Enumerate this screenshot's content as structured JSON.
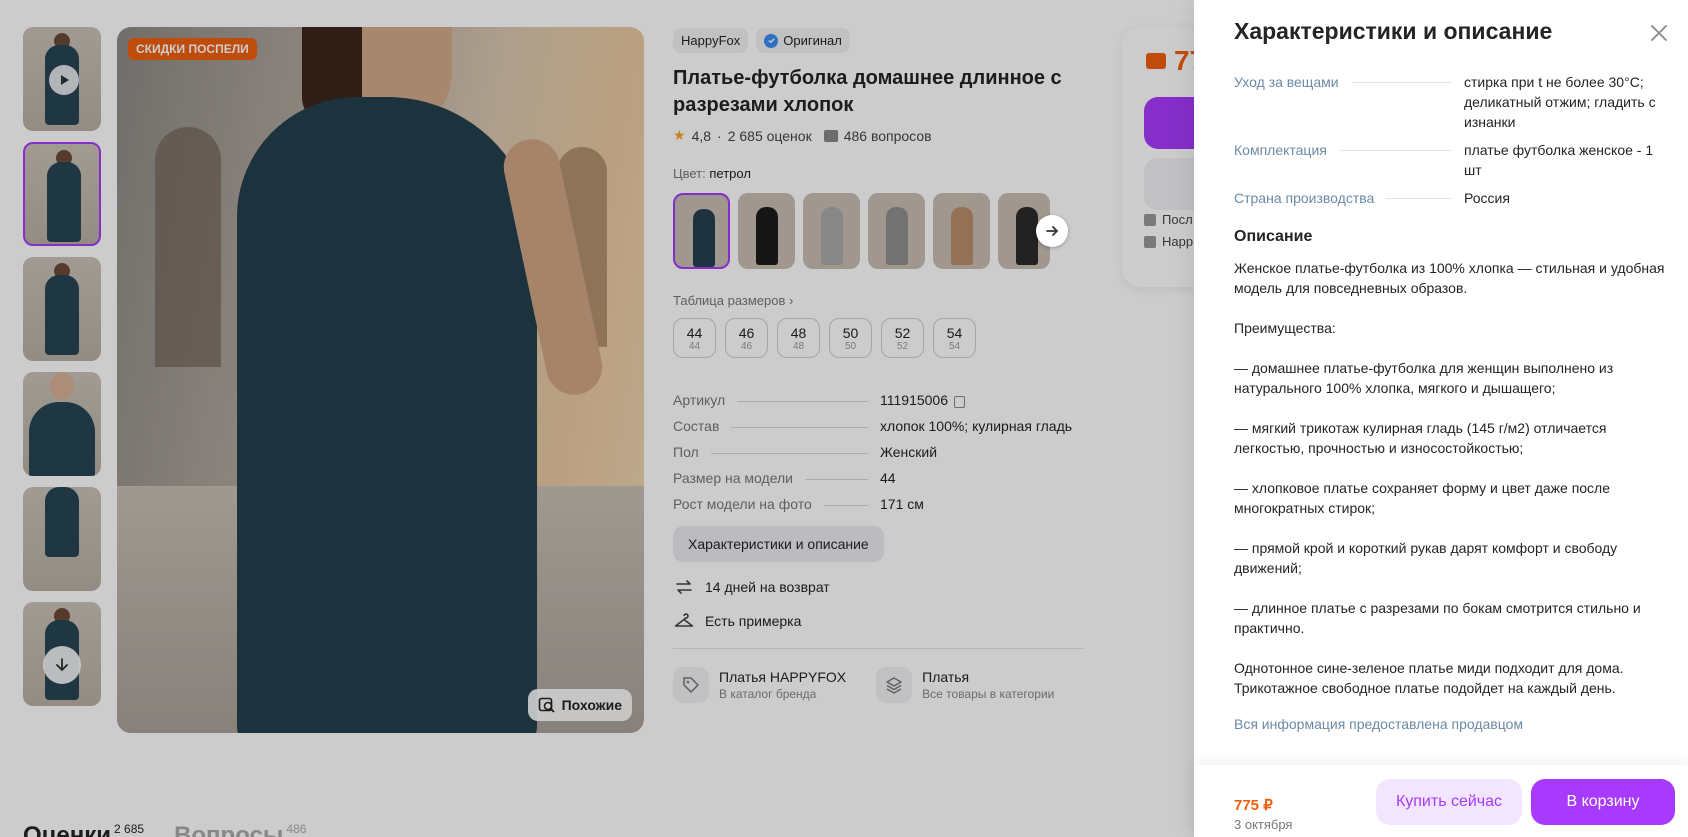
{
  "colors": {
    "accent": "#a73afd",
    "price": "#f0600f",
    "link_muted": "#6b8aa6",
    "badge_sale": "#f0600f"
  },
  "gallery": {
    "sale_badge": "СКИДКИ ПОСПЕЛИ",
    "similar_button": "Похожие",
    "thumbnail_count": 6
  },
  "product": {
    "brand": "HappyFox",
    "original_label": "Оригинал",
    "title": "Платье-футболка домашнее длинное с разрезами хлопок",
    "rating": "4,8",
    "reviews_count": "2 685 оценок",
    "questions_count": "486 вопросов",
    "color_label": "Цвет:",
    "color_value": "петрол",
    "size_table_link": "Таблица размеров",
    "sizes": [
      {
        "ru": "44",
        "alt": "44"
      },
      {
        "ru": "46",
        "alt": "46"
      },
      {
        "ru": "48",
        "alt": "48"
      },
      {
        "ru": "50",
        "alt": "50"
      },
      {
        "ru": "52",
        "alt": "52"
      },
      {
        "ru": "54",
        "alt": "54"
      }
    ],
    "specs": [
      {
        "key": "Артикул",
        "value": "111915006"
      },
      {
        "key": "Состав",
        "value": "хлопок 100%; кулирная гладь"
      },
      {
        "key": "Пол",
        "value": "Женский"
      },
      {
        "key": "Размер на модели",
        "value": "44"
      },
      {
        "key": "Рост модели на фото",
        "value": "171 см"
      }
    ],
    "details_button": "Характеристики и описание",
    "perks": [
      "14 дней на возврат",
      "Есть примерка"
    ],
    "categories": [
      {
        "title": "Платья HAPPYFOX",
        "subtitle": "В каталог бренда"
      },
      {
        "title": "Платья",
        "subtitle": "Все товары в категории"
      }
    ]
  },
  "buybox": {
    "price_partial": "77",
    "line1": "Посл",
    "line2": "Happ"
  },
  "reviews_tabs": {
    "reviews": "Оценки",
    "reviews_count": "2 685",
    "questions": "Вопросы",
    "questions_count": "486"
  },
  "panel": {
    "title": "Характеристики и описание",
    "characteristics": [
      {
        "key": "Уход за вещами",
        "value": "стирка при t не более 30°C; деликатный отжим; гладить с изнанки"
      },
      {
        "key": "Комплектация",
        "value": "платье футболка женское - 1 шт"
      },
      {
        "key": "Страна производства",
        "value": "Россия"
      }
    ],
    "description_title": "Описание",
    "description": "Женское платье-футболка из 100% хлопка — стильная и удобная модель для повседневных образов.\n\nПреимущества:\n\n— домашнее платье-футболка для женщин выполнено из натурального 100% хлопка, мягкого и дышащего;\n\n— мягкий трикотаж кулирная гладь (145 г/м2) отличается легкостью, прочностью и износостойкостью;\n\n— хлопковое платье сохраняет форму и цвет даже после многократных стирок;\n\n— прямой крой и короткий рукав дарят комфорт и свободу движений;\n\n— длинное платье с разрезами по бокам смотрится стильно и практично.\n\nОднотонное сине-зеленое платье миди подходит для дома. Трикотажное свободное платье подойдет на каждый день.",
    "seller_note": "Вся информация предоставлена продавцом",
    "footer": {
      "price": "775 ₽",
      "delivery_date": "3 октября",
      "buy_now": "Купить сейчас",
      "add_to_cart": "В корзину"
    }
  }
}
